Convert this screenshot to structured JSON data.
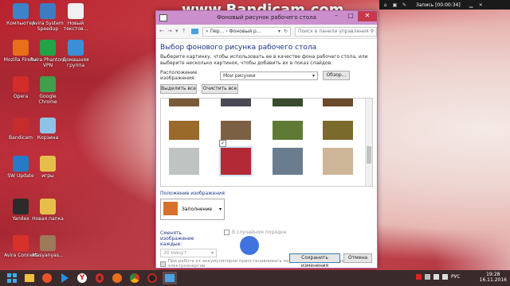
{
  "watermark": "www.Bandicam.com",
  "recording": {
    "text": "Запись [00:00:34]"
  },
  "desktop_icons": [
    {
      "label": "Компьютер",
      "color": "#3c83c9"
    },
    {
      "label": "Avira System Speedup",
      "color": "#3e7cc2"
    },
    {
      "label": "Новый текстов...",
      "color": "#f0f0f0"
    },
    {
      "label": "Mozilla Firefox",
      "color": "#e86f1c"
    },
    {
      "label": "Avira Phantom VPN",
      "color": "#24a246"
    },
    {
      "label": "Домашняя группа",
      "color": "#3b8fd6"
    },
    {
      "label": "Opera",
      "color": "#d42b2b"
    },
    {
      "label": "Google Chrome",
      "color": "#3f9f4a"
    },
    {
      "label": "Bandicam",
      "color": "#c62c2c"
    },
    {
      "label": "Корзина",
      "color": "#8ec2e6"
    },
    {
      "label": "SW Update",
      "color": "#2a78c8"
    },
    {
      "label": "игры",
      "color": "#e6bf4a"
    },
    {
      "label": "Yandex",
      "color": "#2b2b2b"
    },
    {
      "label": "Новая папка",
      "color": "#e6bf4a"
    },
    {
      "label": "Avira Connect",
      "color": "#d8312c"
    },
    {
      "label": "Masyanyas...",
      "color": "#9c7a5a"
    }
  ],
  "window": {
    "title": "Фоновый рисунок рабочего стола",
    "breadcrumb": [
      "Пер...",
      "Фоновый р..."
    ],
    "search_placeholder": "Поиск в панели управления",
    "heading": "Выбор фонового рисунка рабочего стола",
    "description": "Выберите картинку, чтобы использовать ее в качестве фона рабочего стола, или выберите несколько картинок, чтобы добавить их в показ слайдов.",
    "location_label": "Расположение изображения:",
    "location_value": "Мои рисунки",
    "browse_button": "Обзор...",
    "select_all_button": "Выделить все",
    "clear_all_button": "Очистить все",
    "position_label": "Положение изображения:",
    "position_value": "Заполнение",
    "change_label": "Сменять изображение каждые:",
    "interval_value": "30 минут",
    "shuffle_label": "В случайном порядке",
    "battery_label": "При работе от аккумуляторов приостанавливать показ слайдов для экономии электроэнергии",
    "save_button": "Сохранить изменения",
    "cancel_button": "Отмена"
  },
  "gallery": {
    "thumbnails": [
      {
        "color": "#7a5a3a",
        "selected": false
      },
      {
        "color": "#4a4a55",
        "selected": false
      },
      {
        "color": "#3a4a2e",
        "selected": false
      },
      {
        "color": "#6a4a2a",
        "selected": false
      },
      {
        "color": "#9a6a2a",
        "selected": false
      },
      {
        "color": "#7b6043",
        "selected": false
      },
      {
        "color": "#5f7a35",
        "selected": false
      },
      {
        "color": "#7a6a2c",
        "selected": false
      },
      {
        "color": "#bfc3c2",
        "selected": false
      },
      {
        "color": "#b22a35",
        "selected": true
      },
      {
        "color": "#6a7d8f",
        "selected": false
      },
      {
        "color": "#cdb597",
        "selected": false
      }
    ]
  },
  "taskbar": {
    "time": "19:28",
    "date": "16.11.2016",
    "lang": "РУС"
  }
}
